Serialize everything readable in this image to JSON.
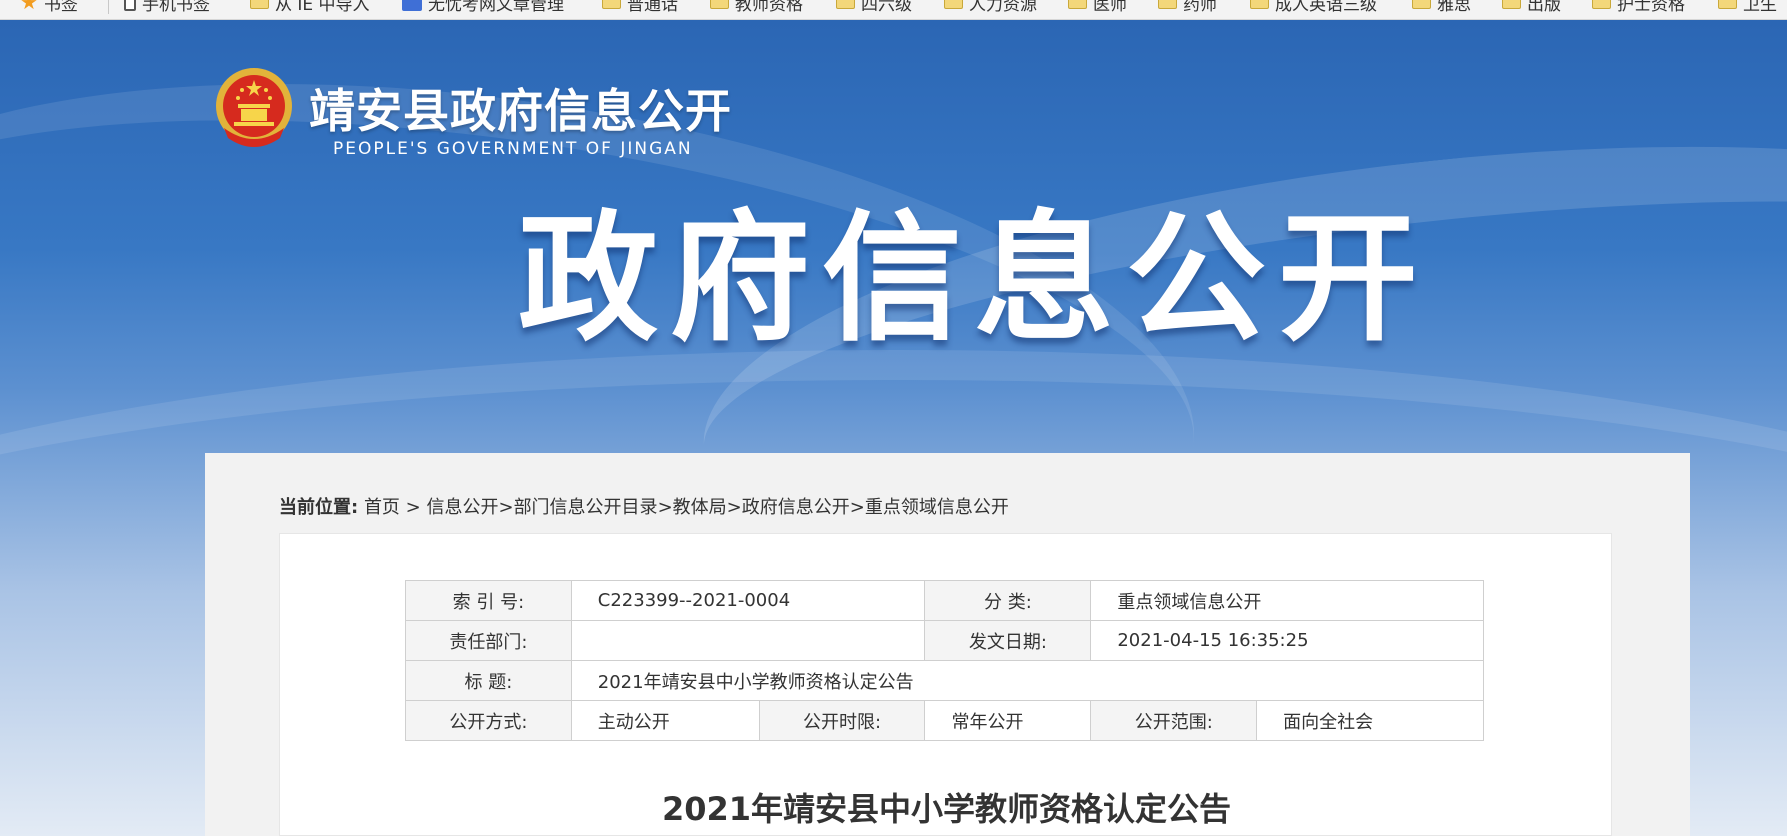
{
  "bookmarks": {
    "items": [
      {
        "label": "书签",
        "icon": "star-icon"
      },
      {
        "label": "手机书签",
        "icon": "phone-icon"
      },
      {
        "label": "从 IE 中导入",
        "icon": "folder-icon"
      },
      {
        "label": "无忧考网文章管理",
        "icon": "site-icon"
      },
      {
        "label": "普通话",
        "icon": "folder-icon"
      },
      {
        "label": "教师资格",
        "icon": "folder-icon"
      },
      {
        "label": "四六级",
        "icon": "folder-icon"
      },
      {
        "label": "人力资源",
        "icon": "folder-icon"
      },
      {
        "label": "医师",
        "icon": "folder-icon"
      },
      {
        "label": "药师",
        "icon": "folder-icon"
      },
      {
        "label": "成人英语三级",
        "icon": "folder-icon"
      },
      {
        "label": "雅思",
        "icon": "folder-icon"
      },
      {
        "label": "出版",
        "icon": "folder-icon"
      },
      {
        "label": "护士资格",
        "icon": "folder-icon"
      },
      {
        "label": "卫生",
        "icon": "folder-icon"
      }
    ]
  },
  "header": {
    "site_title": "靖安县政府信息公开",
    "site_subtitle": "PEOPLE'S GOVERNMENT OF JINGAN",
    "banner_title": "政府信息公开"
  },
  "breadcrumb": {
    "label": "当前位置:",
    "items": [
      "首页",
      "信息公开",
      "部门信息公开目录",
      "教体局",
      "政府信息公开",
      "重点领域信息公开"
    ],
    "first_sep": " > ",
    "sep": ">"
  },
  "meta": {
    "index_label": "索 引 号:",
    "index_value": "C223399--2021-0004",
    "category_label": "分 类:",
    "category_value": "重点领域信息公开",
    "dept_label": "责任部门:",
    "dept_value": "",
    "date_label": "发文日期:",
    "date_value": "2021-04-15 16:35:25",
    "title_label": "标 题:",
    "title_value": "2021年靖安县中小学教师资格认定公告",
    "mode_label": "公开方式:",
    "mode_value": "主动公开",
    "period_label": "公开时限:",
    "period_value": "常年公开",
    "scope_label": "公开范围:",
    "scope_value": "面向全社会"
  },
  "document": {
    "title": "2021年靖安县中小学教师资格认定公告"
  },
  "colors": {
    "banner_top": "#2b66b4",
    "panel_bg": "#f2f2f2",
    "table_border": "#cfcfcf"
  }
}
